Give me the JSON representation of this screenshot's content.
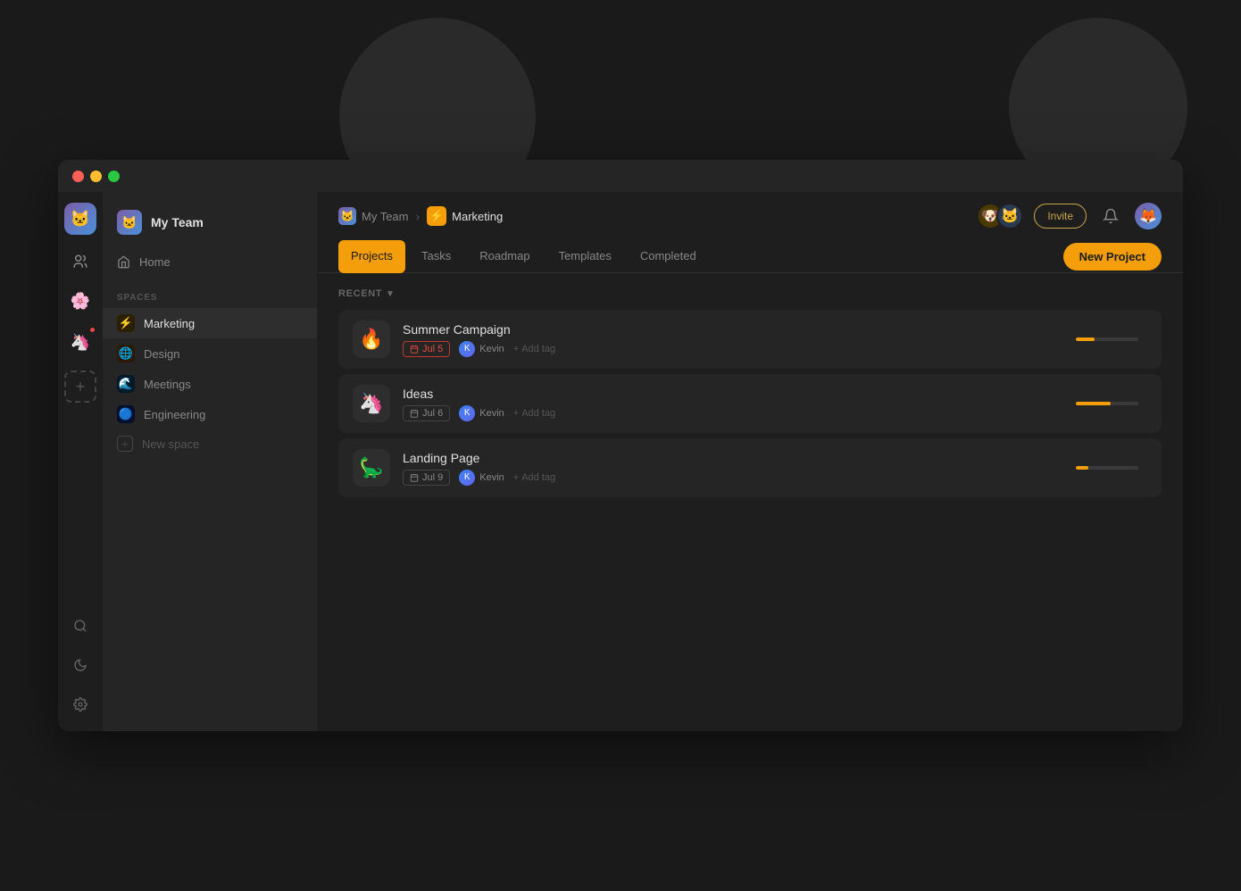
{
  "window": {
    "title": "Marketing"
  },
  "sidebar": {
    "team_name": "My Team",
    "team_emoji": "🐱",
    "nav": [
      {
        "label": "Home",
        "icon": "🏠"
      }
    ],
    "spaces_label": "SPACES",
    "spaces": [
      {
        "label": "Marketing",
        "icon": "⚡",
        "icon_bg": "#f59e0b",
        "active": true
      },
      {
        "label": "Design",
        "icon": "🌐",
        "icon_bg": "#f97316"
      },
      {
        "label": "Meetings",
        "icon": "🌊",
        "icon_bg": "#06b6d4"
      },
      {
        "label": "Engineering",
        "icon": "🔵",
        "icon_bg": "#3b82f6"
      }
    ],
    "new_space_label": "New space"
  },
  "header": {
    "breadcrumb_team": "My Team",
    "breadcrumb_page": "Marketing",
    "invite_label": "Invite",
    "avatars": [
      "🐶",
      "🐱"
    ]
  },
  "tabs": {
    "items": [
      "Projects",
      "Tasks",
      "Roadmap",
      "Templates",
      "Completed"
    ],
    "active": "Projects",
    "new_project_label": "New Project"
  },
  "projects": {
    "section_label": "RECENT",
    "items": [
      {
        "title": "Summer Campaign",
        "emoji": "🔥",
        "date": "Jul 5",
        "date_overdue": true,
        "assignee": "Kevin",
        "progress": 30
      },
      {
        "title": "Ideas",
        "emoji": "🦄",
        "date": "Jul 6",
        "date_overdue": false,
        "assignee": "Kevin",
        "progress": 55
      },
      {
        "title": "Landing Page",
        "emoji": "🦕",
        "date": "Jul 9",
        "date_overdue": false,
        "assignee": "Kevin",
        "progress": 20
      }
    ]
  },
  "icons": {
    "chevron_down": "▾",
    "home": "⌂",
    "plus": "+",
    "search": "⌕",
    "moon": "☾",
    "gear": "⚙",
    "bell": "🔔",
    "calendar": "▤",
    "tag_plus": "+ Add tag"
  }
}
